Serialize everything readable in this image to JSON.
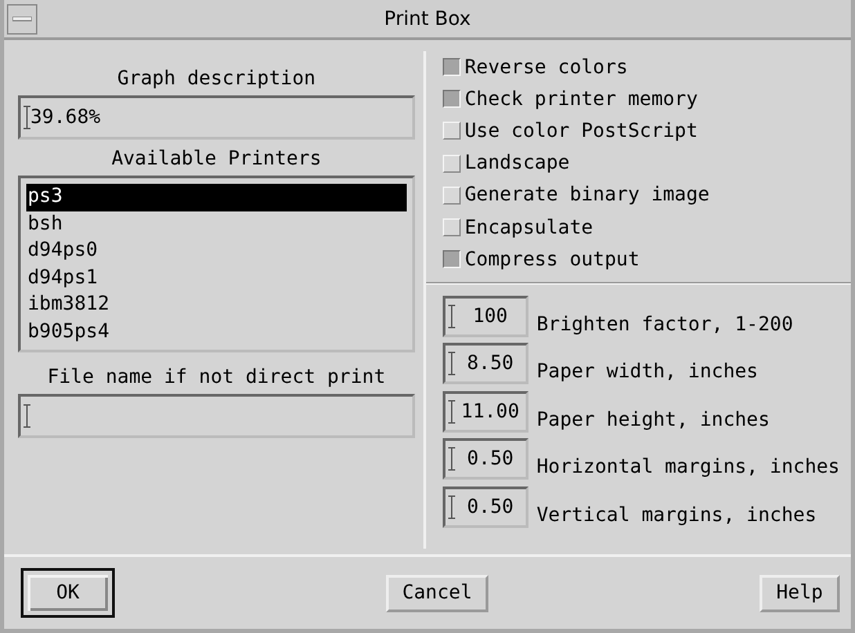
{
  "window": {
    "title": "Print Box"
  },
  "graph_description": {
    "label": "Graph description",
    "value": "39.68%"
  },
  "printers": {
    "label": "Available Printers",
    "items": [
      {
        "name": "ps3",
        "selected": true
      },
      {
        "name": "bsh",
        "selected": false
      },
      {
        "name": "d94ps0",
        "selected": false
      },
      {
        "name": "d94ps1",
        "selected": false
      },
      {
        "name": "ibm3812",
        "selected": false
      },
      {
        "name": "b905ps4",
        "selected": false
      }
    ]
  },
  "file_name": {
    "label": "File name if not direct print"
  },
  "options": [
    {
      "label": "Reverse colors",
      "checked": true
    },
    {
      "label": "Check printer memory",
      "checked": true
    },
    {
      "label": "Use color PostScript",
      "checked": false
    },
    {
      "label": "Landscape",
      "checked": false
    },
    {
      "label": "Generate binary image",
      "checked": false
    },
    {
      "label": "Encapsulate",
      "checked": false
    },
    {
      "label": "Compress output",
      "checked": true
    }
  ],
  "settings": [
    {
      "value": "100",
      "label": "Brighten factor, 1-200"
    },
    {
      "value": "8.50",
      "label": "Paper width, inches"
    },
    {
      "value": "11.00",
      "label": "Paper height, inches"
    },
    {
      "value": "0.50",
      "label": "Horizontal margins, inches"
    },
    {
      "value": "0.50",
      "label": "Vertical margins, inches"
    }
  ],
  "buttons": [
    {
      "label": "OK",
      "default": true
    },
    {
      "label": "Cancel",
      "default": false
    },
    {
      "label": "Help",
      "default": false
    }
  ]
}
